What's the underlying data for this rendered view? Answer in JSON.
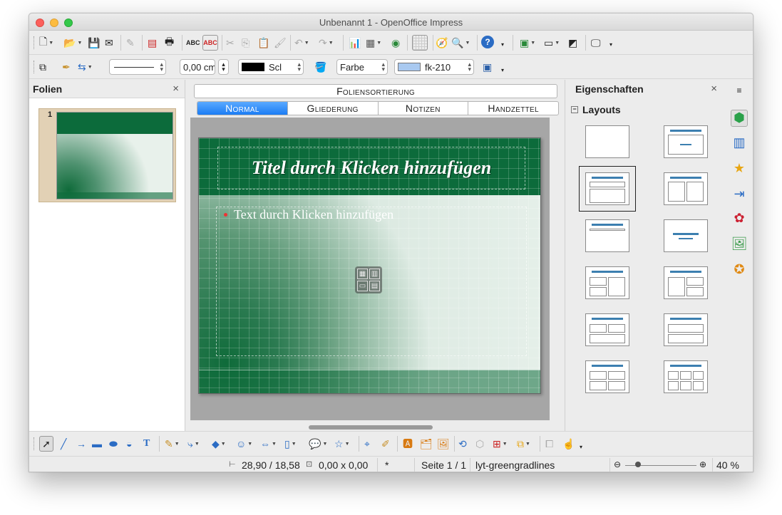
{
  "window": {
    "title": "Unbenannt 1 - OpenOffice Impress"
  },
  "toolbar2": {
    "line_width": "0,00 cm",
    "line_color": "Scl",
    "area_style": "Farbe",
    "area_color": "fk-210"
  },
  "slides_panel": {
    "title": "Folien",
    "slides": [
      {
        "number": "1"
      }
    ]
  },
  "view_tabs": {
    "top": "Foliensortierung",
    "tabs": [
      "Normal",
      "Gliederung",
      "Notizen",
      "Handzettel"
    ],
    "active": "Normal"
  },
  "slide": {
    "title_placeholder": "Titel durch Klicken hinzufügen",
    "body_placeholder": "Text durch Klicken hinzufügen"
  },
  "properties_panel": {
    "title": "Eigenschaften",
    "section": "Layouts",
    "layout_names": [
      "blank",
      "title-content",
      "title-content-selected",
      "title-two-columns",
      "title-only",
      "centered-text",
      "title-2content-and-content",
      "title-content-and-2content",
      "title-2content-over-content",
      "title-content-over-content",
      "title-4content",
      "title-6content"
    ]
  },
  "statusbar": {
    "position": "28,90 / 18,58",
    "size": "0,00 x 0,00",
    "modified": "*",
    "page": "Seite 1 / 1",
    "master": "lyt-greengradlines",
    "zoom": "40 %"
  },
  "colors": {
    "accent_tab": "#1b7cf4",
    "slide_green": "#0c6b3b",
    "layout_bar": "#3c7fb0"
  }
}
